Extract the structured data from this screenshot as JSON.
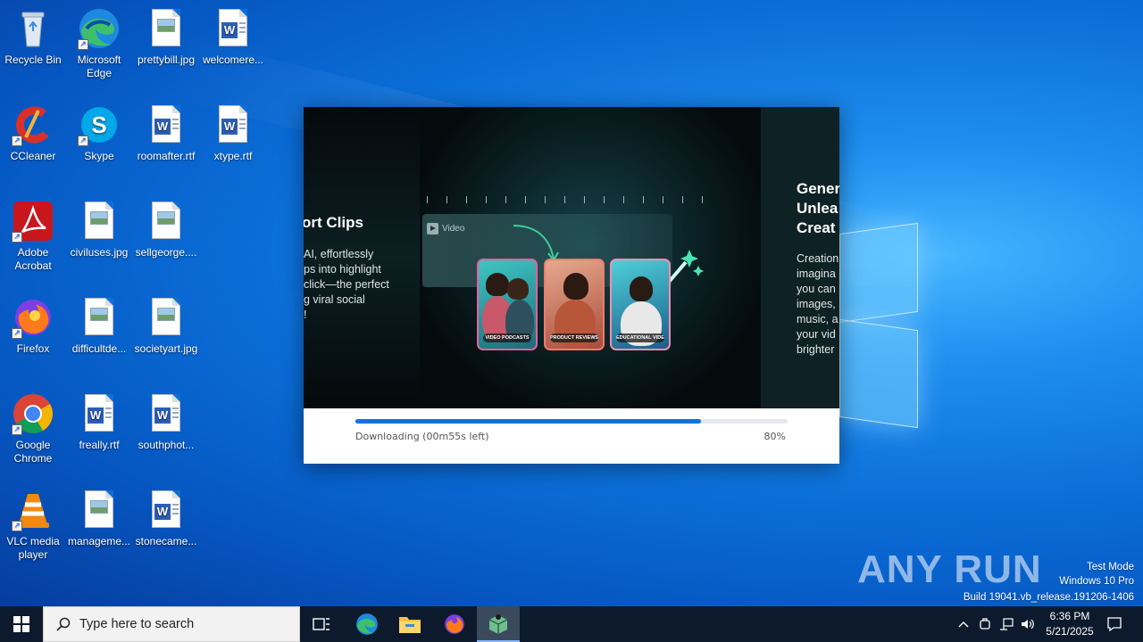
{
  "desktop_icons": [
    {
      "label": "Recycle Bin"
    },
    {
      "label": "Microsoft Edge"
    },
    {
      "label": "prettybill.jpg"
    },
    {
      "label": "welcomere..."
    },
    {
      "label": "CCleaner"
    },
    {
      "label": "Skype"
    },
    {
      "label": "roomafter.rtf"
    },
    {
      "label": "xtype.rtf"
    },
    {
      "label": "Adobe Acrobat"
    },
    {
      "label": "civiluses.jpg"
    },
    {
      "label": "sellgeorge...."
    },
    {
      "label": "Firefox"
    },
    {
      "label": "difficultde..."
    },
    {
      "label": "societyart.jpg"
    },
    {
      "label": "Google Chrome"
    },
    {
      "label": "freally.rtf"
    },
    {
      "label": "southphot..."
    },
    {
      "label": "VLC media player"
    },
    {
      "label": "manageme..."
    },
    {
      "label": "stonecame..."
    }
  ],
  "installer": {
    "left_slide": {
      "title": "ort Clips",
      "lines": [
        "AI, effortlessly",
        "ps into highlight",
        "click—the perfect",
        "g viral social",
        "!"
      ]
    },
    "right_slide": {
      "title_lines": [
        "Gener",
        "Unlea",
        "Creat"
      ],
      "lines": [
        "Creation",
        "imagina",
        "you can",
        "images,",
        "music, a",
        "your vid",
        "brighter"
      ]
    },
    "stage": {
      "video_tag": "Video",
      "cards": [
        {
          "caption": "VIDEO PODCASTS",
          "border": "#e8619a"
        },
        {
          "caption": "PRODUCT REVIEWS",
          "border": "#f07a6a"
        },
        {
          "caption": "EDUCATIONAL VIDEO",
          "border": "#f08fb0"
        }
      ]
    },
    "progress": {
      "status": "Downloading (00m55s left)",
      "percent_label": "80%",
      "percent": 80
    }
  },
  "watermark": {
    "brand": "ANY RUN",
    "mode": "Test Mode",
    "edition": "Windows 10 Pro",
    "build": "Build 19041.vb_release.191206-1406"
  },
  "taskbar": {
    "search_placeholder": "Type here to search",
    "time": "6:36 PM",
    "date": "5/21/2025"
  },
  "colors": {
    "progress_fill": "#1a6fe0",
    "taskbar": "#0d1a2d",
    "desktop": "#0b6fd9"
  }
}
